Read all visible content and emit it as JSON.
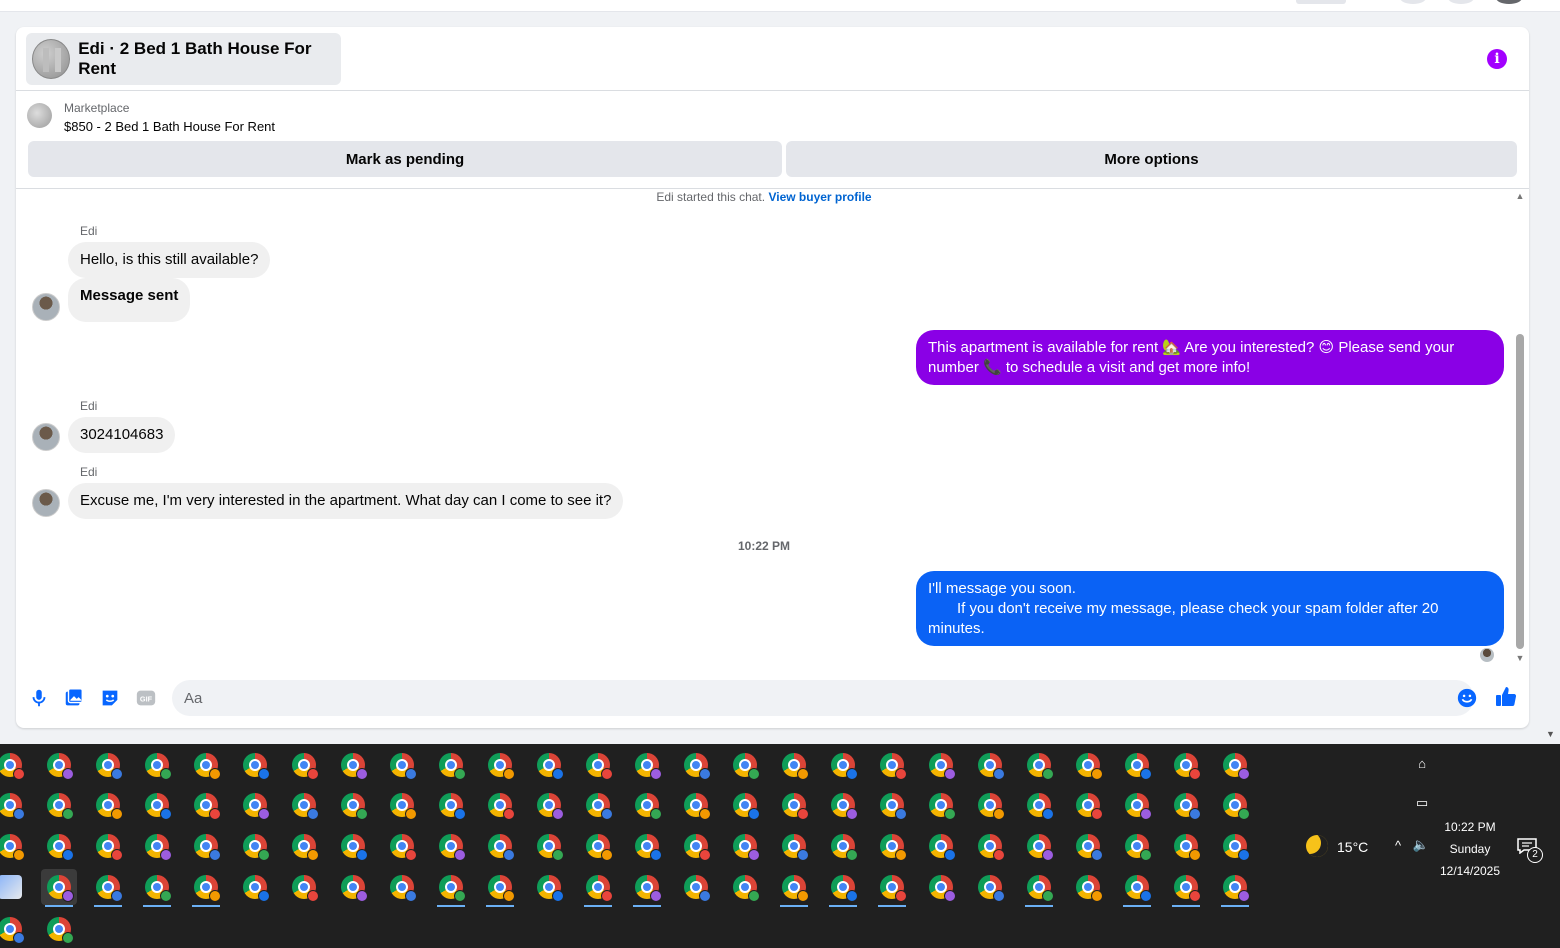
{
  "chat": {
    "title": "Edi · 2 Bed 1 Bath House For Rent",
    "info_icon": "info-icon"
  },
  "listing": {
    "kicker": "Marketplace",
    "title": "$850 - 2 Bed 1 Bath House For Rent",
    "mark_pending": "Mark as pending",
    "more_options": "More options"
  },
  "thread": {
    "started_text": "Edi started this chat.",
    "view_profile": "View buyer profile",
    "messages": [
      {
        "sender": "Edi",
        "text": "Hello, is this still available?"
      },
      {
        "text": "Message sent"
      },
      {
        "outgoing": true,
        "text": "This apartment is available for rent 🏡 Are you interested? 😊 Please send your number 📞 to schedule a visit and get more info!"
      },
      {
        "sender": "Edi",
        "text": "3024104683"
      },
      {
        "sender": "Edi",
        "text": "Excuse me, I'm very interested in the apartment. What day can I come to see it?"
      },
      {
        "outgoing": true,
        "line1": "I'll message you soon.",
        "line2": "If you don't receive my message, please check your spam folder after 20 minutes."
      }
    ],
    "timestamp": "10:22 PM"
  },
  "composer": {
    "placeholder": "Aa",
    "icons": [
      "microphone-icon",
      "photo-icon",
      "sticker-icon",
      "gif-icon",
      "emoji-icon",
      "thumbs-up-icon"
    ],
    "gif_label": "GIF"
  },
  "taskbar": {
    "weather_temp": "15°C",
    "time": "10:22 PM",
    "day": "Sunday",
    "date": "12/14/2025",
    "notification_count": "2"
  },
  "colors": {
    "outgoing_purple": "#8a00e6",
    "outgoing_blue": "#0a62f5",
    "accent_link": "#0064d1",
    "info_purple": "#a200ff"
  }
}
